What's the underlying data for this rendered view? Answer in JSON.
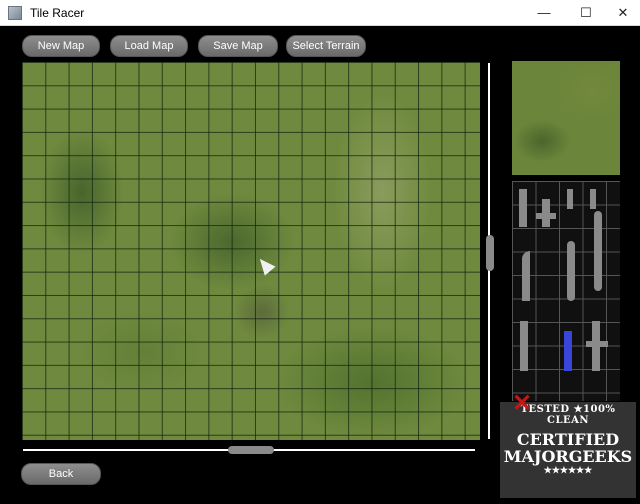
{
  "window": {
    "title": "Tile Racer",
    "minimize_glyph": "—",
    "maximize_glyph": "☐",
    "close_glyph": "✕"
  },
  "toolbar": {
    "new_map": "New Map",
    "load_map": "Load Map",
    "save_map": "Save Map",
    "select_terrain": "Select Terrain"
  },
  "footer": {
    "back": "Back"
  },
  "watermark": {
    "line1": "TESTED ★100% CLEAN",
    "line2": "CERTIFIED",
    "line3": "MAJORGEEKS",
    "stars": "★★★★★★"
  },
  "colors": {
    "grass": "#6f8a3e",
    "button": "#7a7a7a",
    "background": "#000000"
  }
}
